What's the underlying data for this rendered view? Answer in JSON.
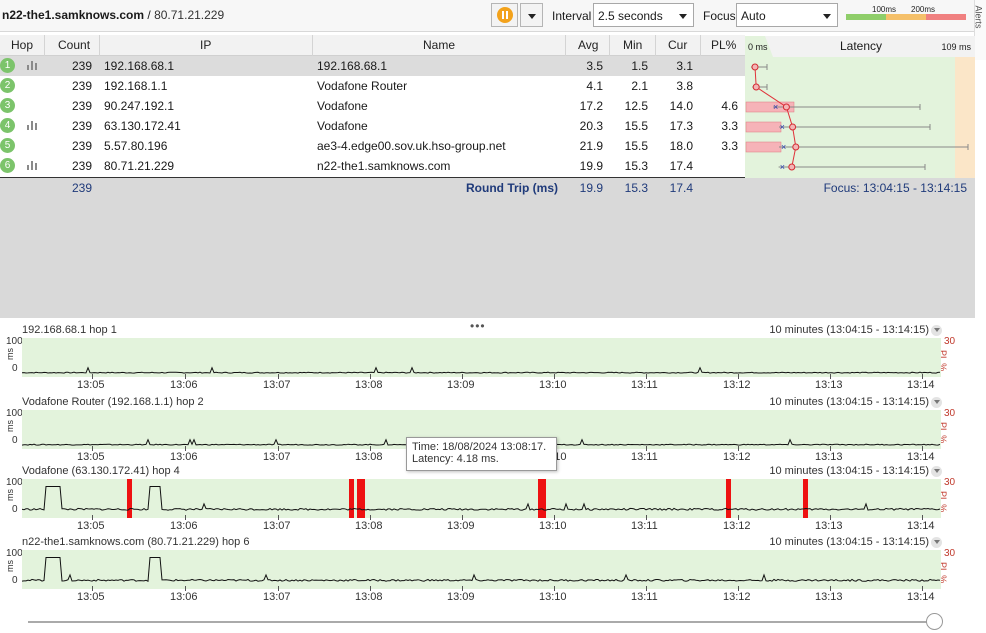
{
  "toolbar": {
    "target_name": "n22-the1.samknows.com",
    "target_sep": " / ",
    "target_ip": "80.71.21.229",
    "interval_label": "Interval",
    "interval_value": "2.5 seconds",
    "focus_label": "Focus",
    "focus_value": "Auto",
    "legend_100": "100ms",
    "legend_200": "200ms",
    "alerts_label": "Alerts"
  },
  "colors": {
    "good": "#8fce6a",
    "warn": "#f5c06a",
    "bad": "#f08080",
    "chart_bg": "#e3f3dc",
    "loss": "#ee1111",
    "hop": "#7cc46b"
  },
  "table": {
    "headers": {
      "hop": "Hop",
      "count": "Count",
      "ip": "IP",
      "name": "Name",
      "avg": "Avg",
      "min": "Min",
      "cur": "Cur",
      "pl": "PL%",
      "latency": "Latency",
      "lat_min": "0 ms",
      "lat_max": "109 ms"
    },
    "rows": [
      {
        "hop": "1",
        "count": "239",
        "ip": "192.168.68.1",
        "name": "192.168.68.1",
        "avg": "3.5",
        "min": "1.5",
        "cur": "3.1",
        "pl": "",
        "bars": true
      },
      {
        "hop": "2",
        "count": "239",
        "ip": "192.168.1.1",
        "name": "Vodafone Router",
        "avg": "4.1",
        "min": "2.1",
        "cur": "3.8",
        "pl": "",
        "bars": false
      },
      {
        "hop": "3",
        "count": "239",
        "ip": "90.247.192.1",
        "name": "Vodafone",
        "avg": "17.2",
        "min": "12.5",
        "cur": "14.0",
        "pl": "4.6",
        "bars": false
      },
      {
        "hop": "4",
        "count": "239",
        "ip": "63.130.172.41",
        "name": "Vodafone",
        "avg": "20.3",
        "min": "15.5",
        "cur": "17.3",
        "pl": "3.3",
        "bars": true
      },
      {
        "hop": "5",
        "count": "239",
        "ip": "5.57.80.196",
        "name": "ae3-4.edge00.sov.uk.hso-group.net",
        "avg": "21.9",
        "min": "15.5",
        "cur": "18.0",
        "pl": "3.3",
        "bars": false
      },
      {
        "hop": "6",
        "count": "239",
        "ip": "80.71.21.229",
        "name": "n22-the1.samknows.com",
        "avg": "19.9",
        "min": "15.3",
        "cur": "17.4",
        "pl": "",
        "bars": true
      }
    ],
    "round_trip": {
      "count": "239",
      "label": "Round Trip (ms)",
      "avg": "19.9",
      "min": "15.3",
      "cur": "17.4",
      "focus": "Focus: 13:04:15 - 13:14:15"
    }
  },
  "charts": [
    {
      "title": "192.168.68.1 hop 1",
      "range": "10 minutes (13:04:15 - 13:14:15)",
      "y_max": "100",
      "y_min": "0",
      "y_unit": "ms",
      "pl_max": "30",
      "pl_unit": "PL %"
    },
    {
      "title": "Vodafone Router (192.168.1.1) hop 2",
      "range": "10 minutes (13:04:15 - 13:14:15)",
      "y_max": "100",
      "y_min": "0",
      "y_unit": "ms",
      "pl_max": "30",
      "pl_unit": "PL %"
    },
    {
      "title": "Vodafone (63.130.172.41) hop 4",
      "range": "10 minutes (13:04:15 - 13:14:15)",
      "y_max": "100",
      "y_min": "0",
      "y_unit": "ms",
      "pl_max": "30",
      "pl_unit": "PL %"
    },
    {
      "title": "n22-the1.samknows.com (80.71.21.229) hop 6",
      "range": "10 minutes (13:04:15 - 13:14:15)",
      "y_max": "100",
      "y_min": "0",
      "y_unit": "ms",
      "pl_max": "30",
      "pl_unit": "PL %"
    }
  ],
  "x_ticks": [
    "13:05",
    "13:06",
    "13:07",
    "13:08",
    "13:09",
    "13:10",
    "13:11",
    "13:12",
    "13:13",
    "13:14"
  ],
  "tooltip": {
    "time": "Time: 18/08/2024 13:08:17.",
    "latency": "Latency: 4.18 ms."
  }
}
